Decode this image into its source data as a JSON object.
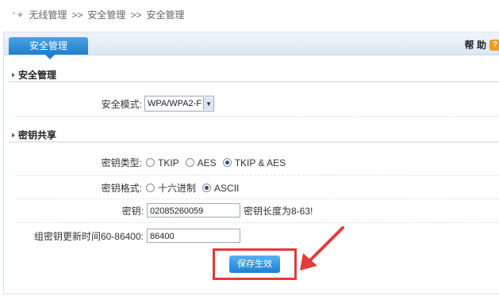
{
  "breadcrumb": {
    "items": [
      "无线管理",
      "安全管理",
      "安全管理"
    ],
    "separator": ">>"
  },
  "tab": {
    "label": "安全管理"
  },
  "help": {
    "label": "帮 助",
    "icon": "?"
  },
  "sections": {
    "security": "安全管理",
    "key_share": "密钥共享"
  },
  "security_mode": {
    "label": "安全模式:",
    "value": "WPA/WPA2-F"
  },
  "key_type": {
    "label": "密钥类型:",
    "options": [
      "TKIP",
      "AES",
      "TKIP & AES"
    ],
    "selected": "TKIP & AES"
  },
  "key_format": {
    "label": "密钥格式:",
    "options": [
      "十六进制",
      "ASCII"
    ],
    "selected": "ASCII"
  },
  "key": {
    "label": "密钥:",
    "value": "02085260059",
    "hint": "密钥长度为8-63!"
  },
  "group_key": {
    "label": "组密钥更新时间60-86400:",
    "value": "86400"
  },
  "save_button": "保存生效",
  "colors": {
    "accent": "#1f7fc9",
    "highlight": "#e23b3b"
  }
}
